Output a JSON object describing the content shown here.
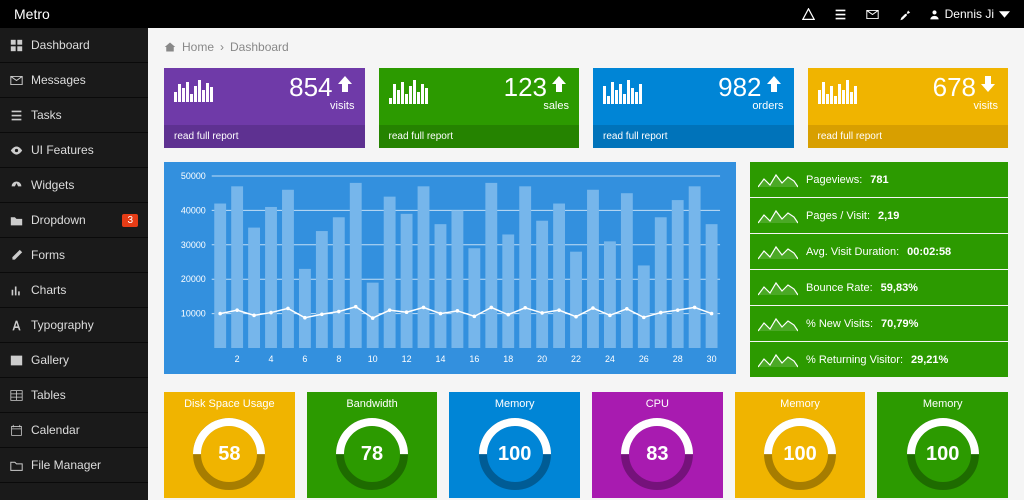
{
  "brand": "Metro",
  "user": {
    "name": "Dennis Ji"
  },
  "breadcrumb": {
    "home": "Home",
    "current": "Dashboard"
  },
  "sidebar": {
    "items": [
      {
        "label": "Dashboard",
        "icon": "dashboard"
      },
      {
        "label": "Messages",
        "icon": "envelope"
      },
      {
        "label": "Tasks",
        "icon": "tasks"
      },
      {
        "label": "UI Features",
        "icon": "eye"
      },
      {
        "label": "Widgets",
        "icon": "gauge"
      },
      {
        "label": "Dropdown",
        "icon": "folder",
        "badge": "3"
      },
      {
        "label": "Forms",
        "icon": "pencil"
      },
      {
        "label": "Charts",
        "icon": "chart"
      },
      {
        "label": "Typography",
        "icon": "font"
      },
      {
        "label": "Gallery",
        "icon": "image"
      },
      {
        "label": "Tables",
        "icon": "table"
      },
      {
        "label": "Calendar",
        "icon": "calendar"
      },
      {
        "label": "File Manager",
        "icon": "foldero"
      }
    ]
  },
  "kpis": [
    {
      "value": "854",
      "label": "visits",
      "color": "purple",
      "report": "read full report",
      "trend": "up"
    },
    {
      "value": "123",
      "label": "sales",
      "color": "green",
      "report": "read full report",
      "trend": "up"
    },
    {
      "value": "982",
      "label": "orders",
      "color": "blue",
      "report": "read full report",
      "trend": "up"
    },
    {
      "value": "678",
      "label": "visits",
      "color": "yellow",
      "report": "read full report",
      "trend": "down"
    }
  ],
  "stats": [
    {
      "label": "Pageviews:",
      "value": "781"
    },
    {
      "label": "Pages / Visit:",
      "value": "2,19"
    },
    {
      "label": "Avg. Visit Duration:",
      "value": "00:02:58"
    },
    {
      "label": "Bounce Rate:",
      "value": "59,83%"
    },
    {
      "label": "% New Visits:",
      "value": "70,79%"
    },
    {
      "label": "% Returning Visitor:",
      "value": "29,21%"
    }
  ],
  "donuts": [
    {
      "title": "Disk Space Usage",
      "value": "58",
      "color": "yellow"
    },
    {
      "title": "Bandwidth",
      "value": "78",
      "color": "green"
    },
    {
      "title": "Memory",
      "value": "100",
      "color": "blue"
    },
    {
      "title": "CPU",
      "value": "83",
      "color": "purple"
    },
    {
      "title": "Memory",
      "value": "100",
      "color": "yellow"
    },
    {
      "title": "Memory",
      "value": "100",
      "color": "green"
    }
  ],
  "chart_data": {
    "type": "bar+line",
    "ylim": [
      0,
      50000
    ],
    "yticks": [
      10000,
      20000,
      30000,
      40000,
      50000
    ],
    "xticks": [
      2,
      4,
      6,
      8,
      10,
      12,
      14,
      16,
      18,
      20,
      22,
      24,
      26,
      28,
      30
    ],
    "bars": [
      42000,
      47000,
      35000,
      41000,
      46000,
      23000,
      34000,
      38000,
      48000,
      19000,
      44000,
      39000,
      47000,
      36000,
      40000,
      29000,
      48000,
      33000,
      47000,
      37000,
      42000,
      28000,
      46000,
      31000,
      45000,
      24000,
      38000,
      43000,
      47000,
      36000
    ],
    "line": [
      10000,
      11000,
      9500,
      10300,
      11500,
      8800,
      9800,
      10600,
      12000,
      8700,
      11000,
      10400,
      11800,
      10000,
      10800,
      9200,
      11800,
      9700,
      11700,
      10200,
      11000,
      9100,
      11600,
      9500,
      11400,
      8900,
      10300,
      11000,
      11800,
      10000
    ]
  }
}
